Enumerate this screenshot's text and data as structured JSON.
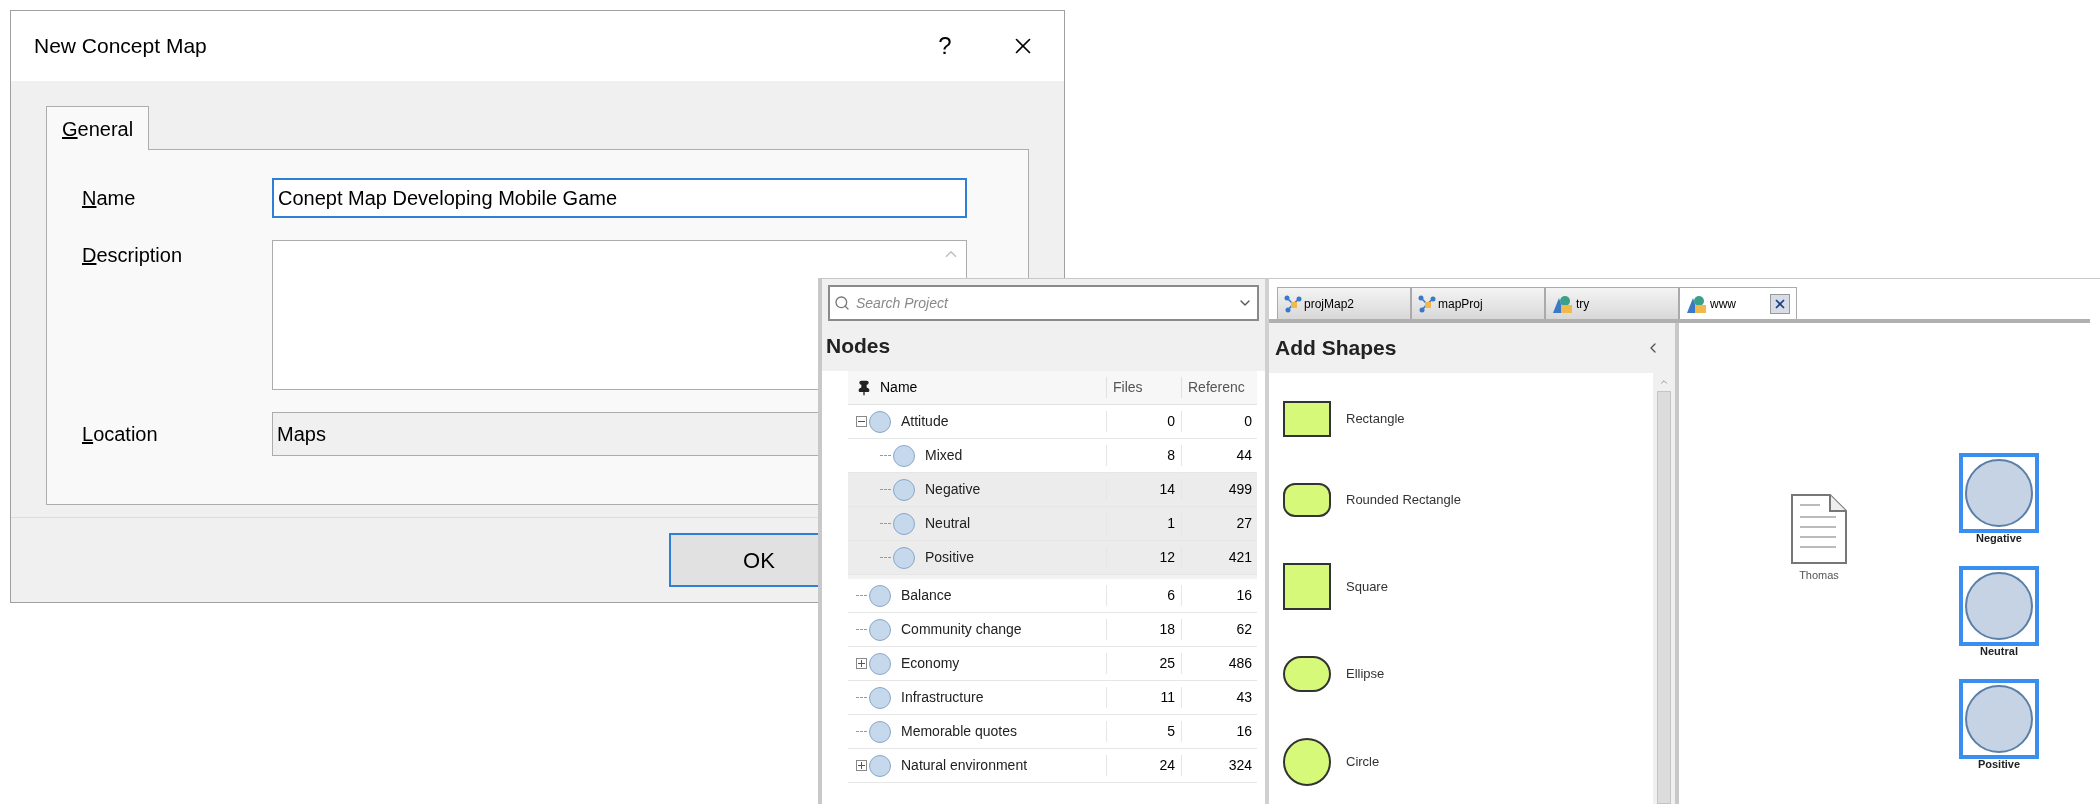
{
  "dialog": {
    "title": "New Concept Map",
    "help_button": "?",
    "tabs": [
      {
        "label": "General",
        "selected": true
      }
    ],
    "fields": [
      {
        "label": "Name",
        "kind": "text",
        "value": "Conept Map Developing Mobile Game",
        "focused": true
      },
      {
        "label": "Description",
        "kind": "multiline",
        "focused": false
      },
      {
        "label": "Location",
        "kind": "readonly",
        "value": "Maps",
        "focused": false
      }
    ],
    "buttons": [
      "OK"
    ]
  },
  "project": {
    "search": {
      "placeholder": "Search Project"
    },
    "title": "Nodes",
    "columns": [
      "Name",
      "Files",
      "Referenc"
    ],
    "rows": [
      {
        "name": "Attitude",
        "files": "0",
        "references": "0",
        "expanded": true,
        "selected": false,
        "children": [
          {
            "name": "Mixed",
            "files": "8",
            "references": "44",
            "selected": false
          },
          {
            "name": "Negative",
            "files": "14",
            "references": "499",
            "selected": true
          },
          {
            "name": "Neutral",
            "files": "1",
            "references": "27",
            "selected": true
          },
          {
            "name": "Positive",
            "files": "12",
            "references": "421",
            "selected": true
          }
        ]
      },
      {
        "name": "Balance",
        "files": "6",
        "references": "16",
        "selected": false
      },
      {
        "name": "Community change",
        "files": "18",
        "references": "62",
        "selected": false
      },
      {
        "name": "Economy",
        "files": "25",
        "references": "486",
        "expanded": false,
        "selected": false
      },
      {
        "name": "Infrastructure",
        "files": "11",
        "references": "43",
        "selected": false
      },
      {
        "name": "Memorable quotes",
        "files": "5",
        "references": "16",
        "selected": false
      },
      {
        "name": "Natural environment",
        "files": "24",
        "references": "324",
        "expanded": false,
        "selected": false
      }
    ]
  },
  "doc_tabs": [
    {
      "label": "projMap2",
      "kind": "map",
      "selected": false
    },
    {
      "label": "mapProj",
      "kind": "map",
      "selected": false
    },
    {
      "label": "try",
      "kind": "chart",
      "selected": false
    },
    {
      "label": "www",
      "kind": "chart",
      "selected": true
    }
  ],
  "shapes_panel": {
    "title": "Add Shapes",
    "shapes": [
      {
        "label": "Rectangle",
        "kind": "rectangle"
      },
      {
        "label": "Rounded Rectangle",
        "kind": "rounded"
      },
      {
        "label": "Square",
        "kind": "square"
      },
      {
        "label": "Ellipse",
        "kind": "ellipse"
      },
      {
        "label": "Circle",
        "kind": "circle"
      }
    ]
  },
  "canvas": {
    "items": [
      {
        "label": "Negative",
        "kind": "node",
        "selected": true
      },
      {
        "label": "Thomas",
        "kind": "document",
        "selected": false
      },
      {
        "label": "Neutral",
        "kind": "node",
        "selected": true
      },
      {
        "label": "Positive",
        "kind": "node",
        "selected": true
      }
    ]
  }
}
